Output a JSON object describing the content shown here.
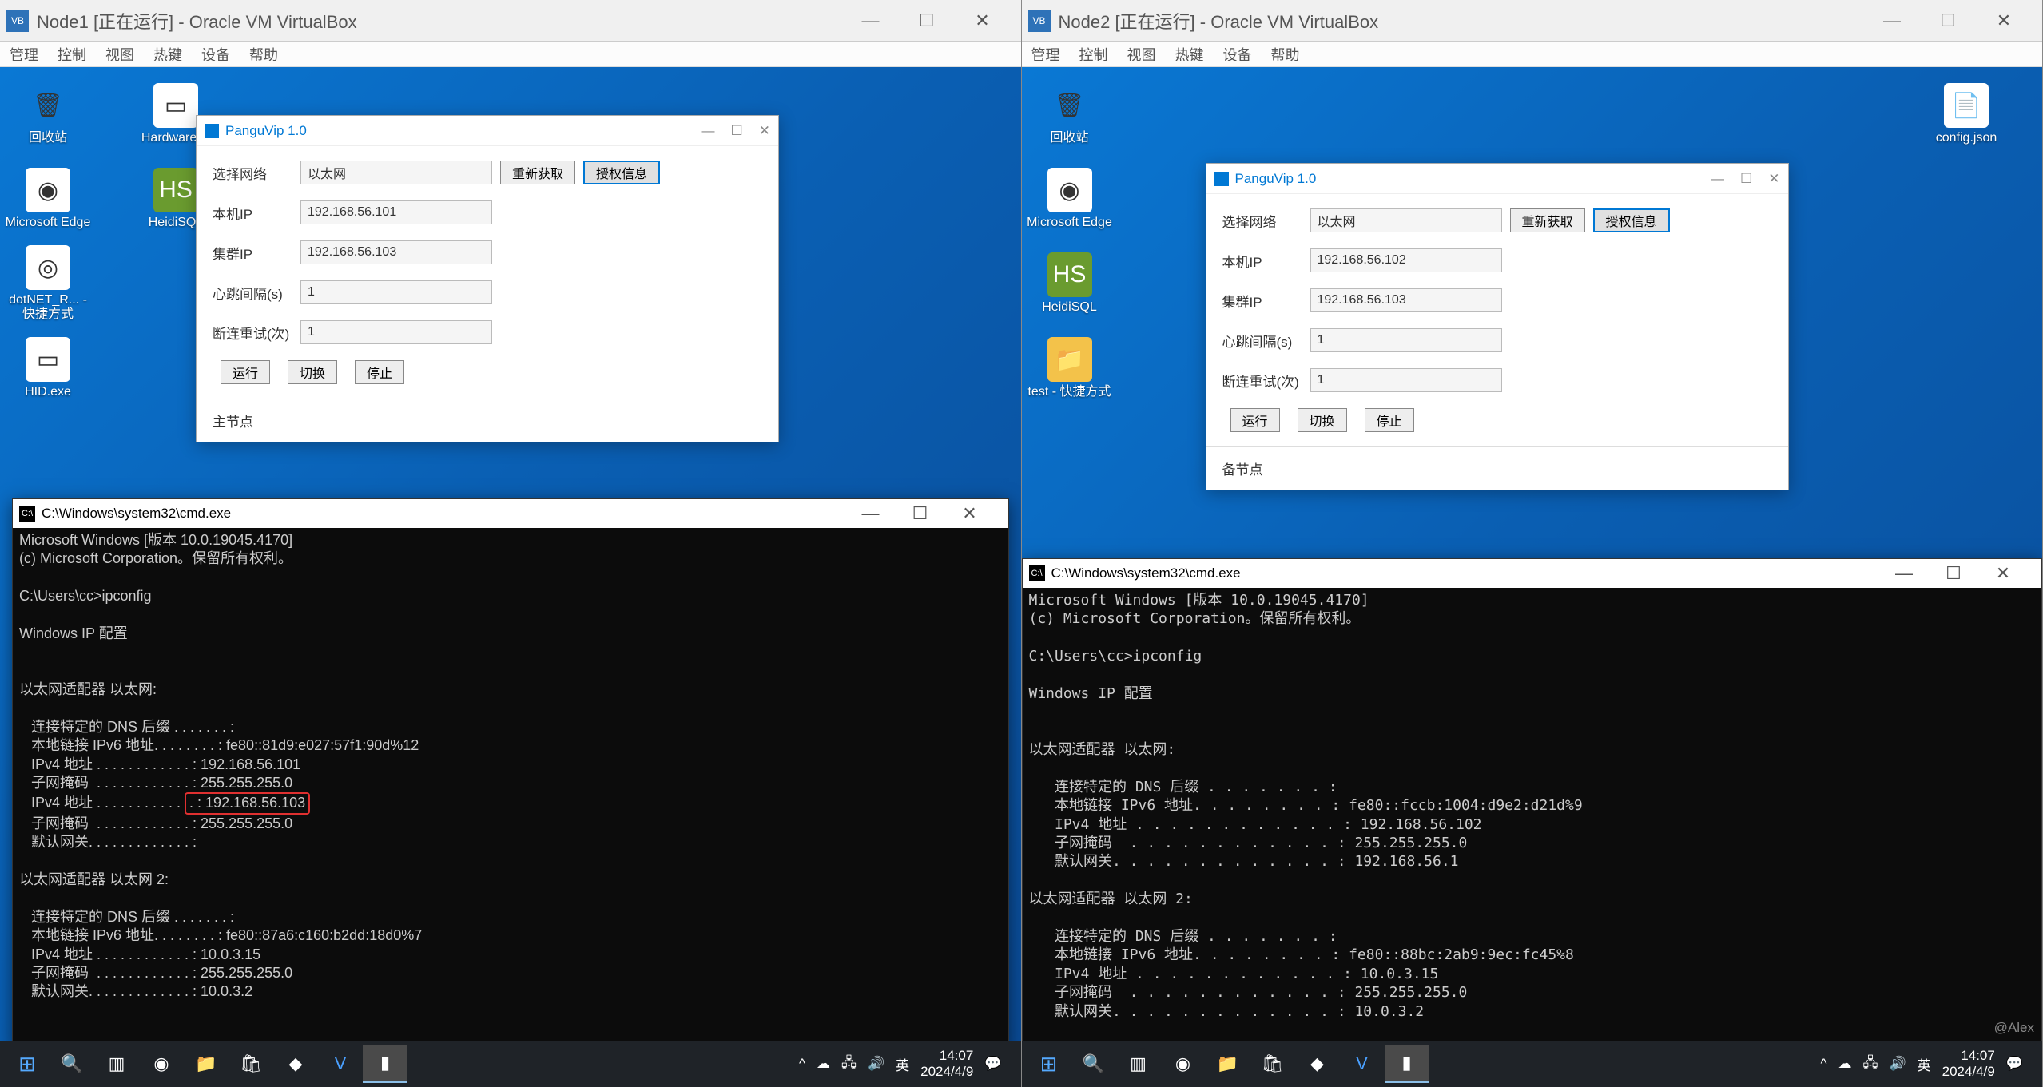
{
  "left": {
    "vb_title": "Node1 [正在运行] - Oracle VM VirtualBox",
    "menus": [
      "管理",
      "控制",
      "视图",
      "热键",
      "设备",
      "帮助"
    ],
    "desktop_icons": [
      {
        "label": "回收站",
        "glyph": "🗑"
      },
      {
        "label": "HID.exe",
        "glyph": "▭"
      },
      {
        "label": "Microsoft Edge",
        "glyph": "◉"
      },
      {
        "label": "Hardwarel...",
        "glyph": "▭"
      },
      {
        "label": "dotNET_R... -快捷方式",
        "glyph": "◎"
      },
      {
        "label": "HeidiSQL",
        "glyph": "HS"
      }
    ],
    "pangu": {
      "title": "PanguVip 1.0",
      "fields": {
        "net_lbl": "选择网络",
        "net_val": "以太网",
        "btn_refresh": "重新获取",
        "btn_auth": "授权信息",
        "ip_lbl": "本机IP",
        "ip_val": "192.168.56.101",
        "cluster_lbl": "集群IP",
        "cluster_val": "192.168.56.103",
        "heartbeat_lbl": "心跳间隔(s)",
        "heartbeat_val": "1",
        "retry_lbl": "断连重试(次)",
        "retry_val": "1",
        "btn_run": "运行",
        "btn_switch": "切换",
        "btn_stop": "停止"
      },
      "status": "主节点"
    },
    "cmd": {
      "title": "C:\\Windows\\system32\\cmd.exe",
      "lines_pre": "Microsoft Windows [版本 10.0.19045.4170]\n(c) Microsoft Corporation。保留所有权利。\n\nC:\\Users\\cc>ipconfig\n\nWindows IP 配置\n\n\n以太网适配器 以太网:\n\n   连接特定的 DNS 后缀 . . . . . . . :\n   本地链接 IPv6 地址. . . . . . . . : fe80::81d9:e027:57f1:90d%12\n   IPv4 地址 . . . . . . . . . . . . : 192.168.56.101\n   子网掩码  . . . . . . . . . . . . : 255.255.255.0",
      "hl_line_pre": "   IPv4 地址 . . . . . . . . . . . ",
      "hl_text": ". : 192.168.56.103",
      "lines_post": "   子网掩码  . . . . . . . . . . . . : 255.255.255.0\n   默认网关. . . . . . . . . . . . . :\n\n以太网适配器 以太网 2:\n\n   连接特定的 DNS 后缀 . . . . . . . :\n   本地链接 IPv6 地址. . . . . . . . : fe80::87a6:c160:b2dd:18d0%7\n   IPv4 地址 . . . . . . . . . . . . : 10.0.3.15\n   子网掩码  . . . . . . . . . . . . : 255.255.255.0\n   默认网关. . . . . . . . . . . . . : 10.0.3.2\n"
    },
    "clock_time": "14:07",
    "clock_date": "2024/4/9",
    "ime": "英"
  },
  "right": {
    "vb_title": "Node2 [正在运行] - Oracle VM VirtualBox",
    "menus": [
      "管理",
      "控制",
      "视图",
      "热键",
      "设备",
      "帮助"
    ],
    "desktop_icons": [
      {
        "label": "回收站",
        "glyph": "🗑"
      },
      {
        "label": "Microsoft Edge",
        "glyph": "◉"
      },
      {
        "label": "HeidiSQL",
        "glyph": "HS"
      },
      {
        "label": "test - 快捷方式",
        "glyph": "📁"
      }
    ],
    "cfg_icon": {
      "label": "config.json",
      "glyph": "📄"
    },
    "pangu": {
      "title": "PanguVip 1.0",
      "fields": {
        "net_lbl": "选择网络",
        "net_val": "以太网",
        "btn_refresh": "重新获取",
        "btn_auth": "授权信息",
        "ip_lbl": "本机IP",
        "ip_val": "192.168.56.102",
        "cluster_lbl": "集群IP",
        "cluster_val": "192.168.56.103",
        "heartbeat_lbl": "心跳间隔(s)",
        "heartbeat_val": "1",
        "retry_lbl": "断连重试(次)",
        "retry_val": "1",
        "btn_run": "运行",
        "btn_switch": "切换",
        "btn_stop": "停止"
      },
      "status": "备节点"
    },
    "cmd": {
      "title": "C:\\Windows\\system32\\cmd.exe",
      "lines": "Microsoft Windows [版本 10.0.19045.4170]\n(c) Microsoft Corporation。保留所有权利。\n\nC:\\Users\\cc>ipconfig\n\nWindows IP 配置\n\n\n以太网适配器 以太网:\n\n   连接特定的 DNS 后缀 . . . . . . . :\n   本地链接 IPv6 地址. . . . . . . . : fe80::fccb:1004:d9e2:d21d%9\n   IPv4 地址 . . . . . . . . . . . . : 192.168.56.102\n   子网掩码  . . . . . . . . . . . . : 255.255.255.0\n   默认网关. . . . . . . . . . . . . : 192.168.56.1\n\n以太网适配器 以太网 2:\n\n   连接特定的 DNS 后缀 . . . . . . . :\n   本地链接 IPv6 地址. . . . . . . . : fe80::88bc:2ab9:9ec:fc45%8\n   IPv4 地址 . . . . . . . . . . . . : 10.0.3.15\n   子网掩码  . . . . . . . . . . . . : 255.255.255.0\n   默认网关. . . . . . . . . . . . . : 10.0.3.2\n"
    },
    "clock_time": "14:07",
    "clock_date": "2024/4/9",
    "ime": "英",
    "watermark": "@Alex"
  },
  "win_btns": {
    "min": "—",
    "max": "☐",
    "close": "✕"
  }
}
